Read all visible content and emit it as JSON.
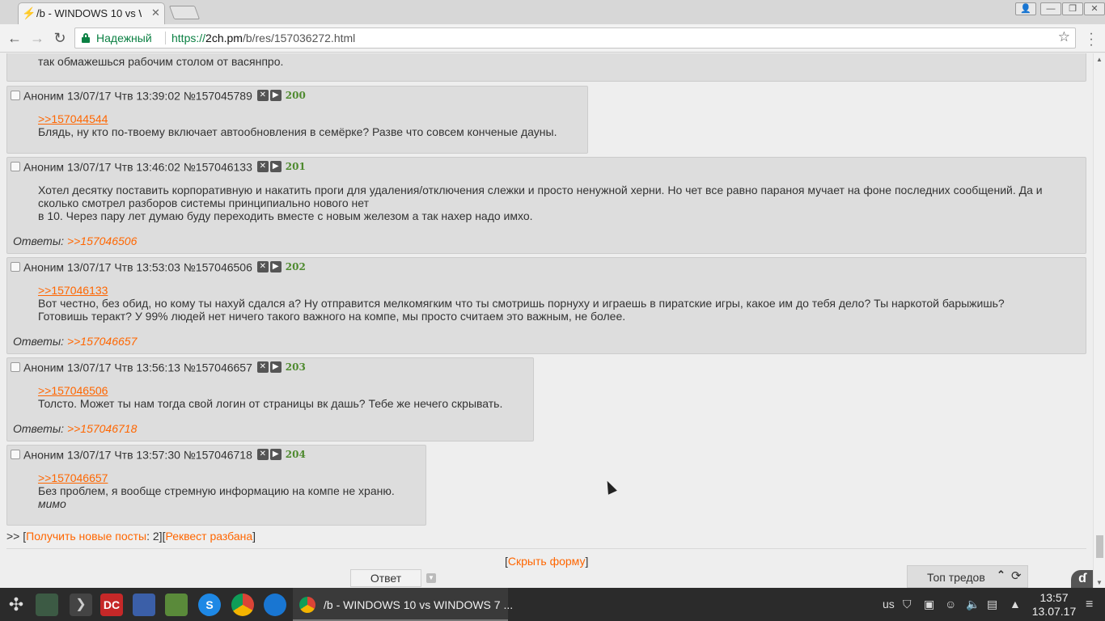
{
  "browser": {
    "tab_title": "/b - WINDOWS 10 vs W",
    "secure_label": "Надежный",
    "url_scheme": "https://",
    "url_host": "2ch.pm",
    "url_path": "/b/res/157036272.html"
  },
  "thread": {
    "top_line": "так обмажешься рабочим столом от васянпро.",
    "answers_label": "Ответы:",
    "posts": [
      {
        "author": "Аноним",
        "date": "13/07/17 Чтв 13:39:02",
        "id": "№157045789",
        "number": "200",
        "reply_to": ">>157044544",
        "lines": [
          "Блядь, ну кто по-твоему включает автообновления в семёрке? Разве что совсем конченые дауны."
        ],
        "answers": ""
      },
      {
        "author": "Аноним",
        "date": "13/07/17 Чтв 13:46:02",
        "id": "№157046133",
        "number": "201",
        "reply_to": "",
        "lines": [
          "Хотел десятку поставить корпоративную и накатить проги для удаления/отключения слежки и просто ненужной херни. Но чет все равно параноя мучает на фоне последних сообщений. Да и",
          "сколько смотрел разборов системы принципиально нового нет",
          "в 10. Через пару лет думаю буду переходить вместе с новым железом а так нахер надо имхо."
        ],
        "answers": ">>157046506"
      },
      {
        "author": "Аноним",
        "date": "13/07/17 Чтв 13:53:03",
        "id": "№157046506",
        "number": "202",
        "reply_to": ">>157046133",
        "lines": [
          "Вот честно, без обид, но кому ты нахуй сдался а? Ну отправится мелкомягким что ты смотришь порнуху и играешь в пиратские игры, какое им до тебя дело? Ты наркотой барыжишь?",
          "Готовишь теракт? У 99% людей нет ничего такого важного на компе, мы просто считаем это важным, не более."
        ],
        "answers": ">>157046657"
      },
      {
        "author": "Аноним",
        "date": "13/07/17 Чтв 13:56:13",
        "id": "№157046657",
        "number": "203",
        "reply_to": ">>157046506",
        "lines": [
          "Толсто. Может ты нам тогда свой логин от страницы вк дашь? Тебе же нечего скрывать."
        ],
        "answers": ">>157046718"
      },
      {
        "author": "Аноним",
        "date": "13/07/17 Чтв 13:57:30",
        "id": "№157046718",
        "number": "204",
        "reply_to": ">>157046657",
        "lines": [
          "Без проблем, я вообще стремную информацию на компе не храню."
        ],
        "signature": "мимо",
        "answers": ""
      }
    ],
    "new_posts_prefix": ">> [",
    "new_posts_link": "Получить новые посты",
    "new_posts_count": ": 2][",
    "request_ban_link": "Реквест разбана",
    "new_posts_suffix": "]",
    "hide_form_link": "Скрыть форму",
    "reply_button": "Ответ",
    "top_threads": "Топ тредов"
  },
  "taskbar": {
    "window_title": "/b - WINDOWS 10 vs WINDOWS 7 ...",
    "keyboard_layout": "us",
    "time": "13:57",
    "date": "13.07.17"
  }
}
